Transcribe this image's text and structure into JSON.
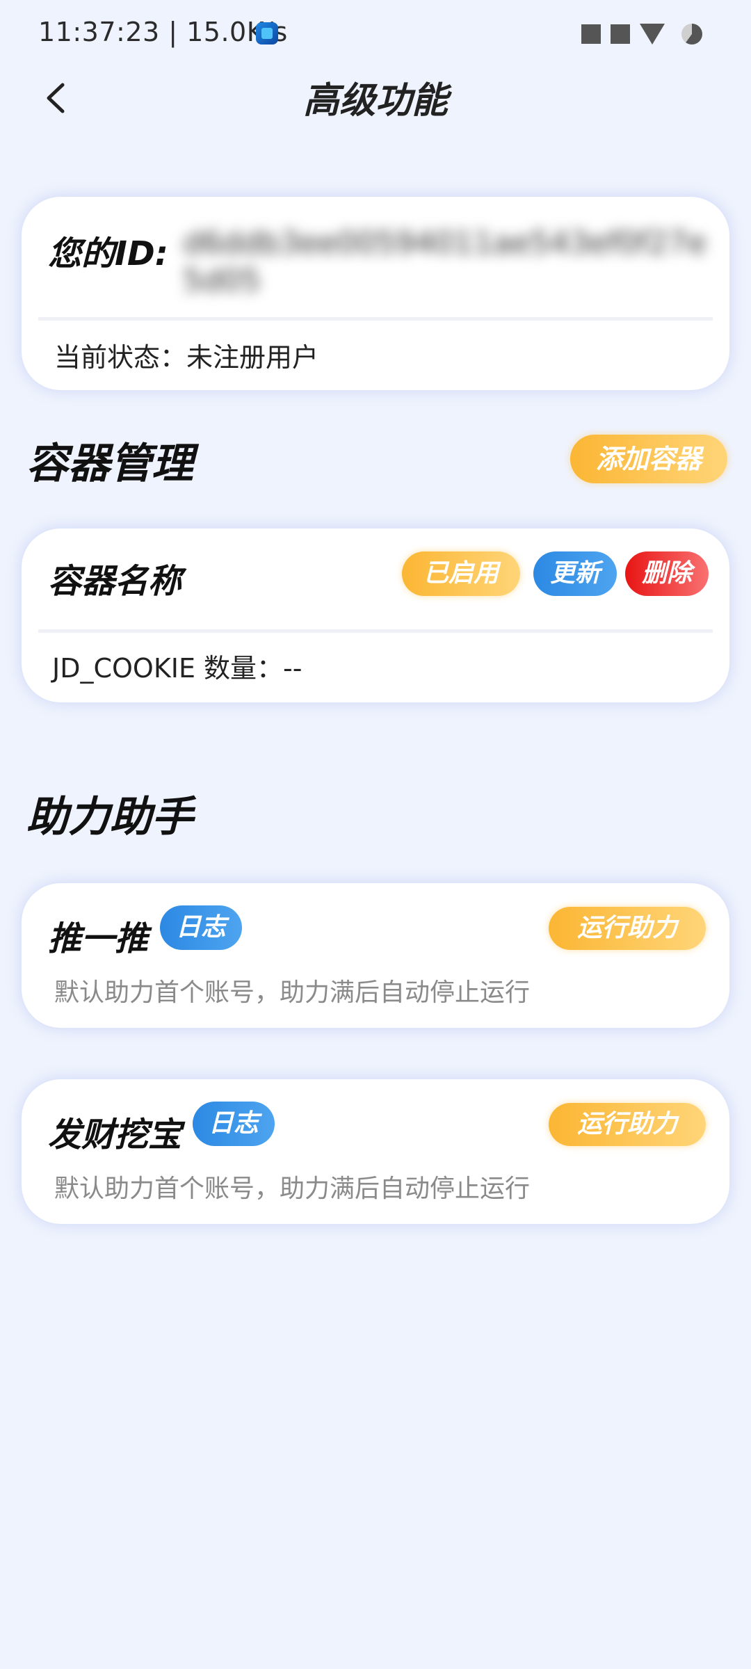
{
  "status_bar": {
    "time_speed": "11:37:23 | 15.0K/s",
    "icons": [
      "app-icon",
      "notification-icon",
      "notification-icon",
      "wifi-icon",
      "battery-icon"
    ]
  },
  "header": {
    "title": "高级功能",
    "back_icon": "chevron-left-icon"
  },
  "id_card": {
    "label": "您的ID:",
    "value": "d6ddb3ee00594011ae543ef0f27e5d05",
    "status_label": "当前状态：",
    "status_value": "未注册用户"
  },
  "container_section": {
    "title": "容器管理",
    "add_button": "添加容器",
    "card": {
      "name": "容器名称",
      "enabled_button": "已启用",
      "update_button": "更新",
      "delete_button": "删除",
      "cookie_label": "JD_COOKIE 数量：",
      "cookie_value": "--"
    }
  },
  "helper_section": {
    "title": "助力助手",
    "items": [
      {
        "name": "推一推",
        "log_button": "日志",
        "run_button": "运行助力",
        "description": "默认助力首个账号，助力满后自动停止运行"
      },
      {
        "name": "发财挖宝",
        "log_button": "日志",
        "run_button": "运行助力",
        "description": "默认助力首个账号，助力满后自动停止运行"
      }
    ]
  },
  "colors": {
    "background": "#eff3fd",
    "accent_orange": "#fbb634",
    "accent_blue": "#2c89e3",
    "accent_red": "#e81515"
  }
}
